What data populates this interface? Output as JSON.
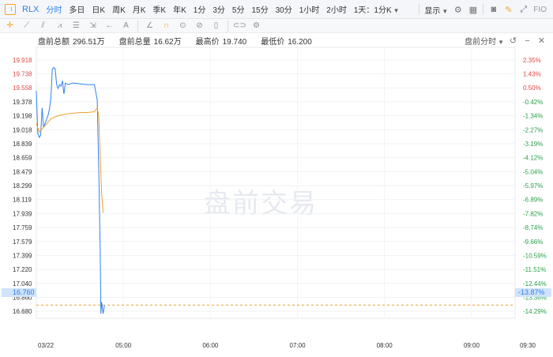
{
  "toolbar": {
    "symbol": "RLX",
    "periods": [
      "分时",
      "多日",
      "日K",
      "周K",
      "月K",
      "季K",
      "年K",
      "1分",
      "3分",
      "5分",
      "15分",
      "30分",
      "1小时",
      "2小时",
      "1天：1分K"
    ],
    "active_period": "分时",
    "display_label": "显示",
    "fio_label": "FIO"
  },
  "info": {
    "total_amount_label": "盘前总额",
    "total_amount": "296.51万",
    "total_volume_label": "盘前总量",
    "total_volume": "16.62万",
    "high_label": "最高价",
    "high": "19.740",
    "low_label": "最低价",
    "low": "16.200",
    "mode_label": "盘前分时"
  },
  "watermark": "盘前交易",
  "current": {
    "price": "16.760",
    "pct": "-13.87%"
  },
  "chart_data": {
    "type": "line",
    "y_left_ticks": [
      "19.918",
      "19.738",
      "19.558",
      "19.378",
      "19.198",
      "19.018",
      "18.839",
      "18.659",
      "18.479",
      "18.299",
      "18.119",
      "17.939",
      "17.759",
      "17.579",
      "17.399",
      "17.220",
      "17.040",
      "16.860",
      "16.680"
    ],
    "y_right_ticks": [
      "2.35%",
      "1.43%",
      "0.50%",
      "-0.42%",
      "-1.34%",
      "-2.27%",
      "-3.19%",
      "-4.12%",
      "-5.04%",
      "-5.97%",
      "-6.89%",
      "-7.82%",
      "-8.74%",
      "-9.66%",
      "-10.59%",
      "-11.51%",
      "-12.44%",
      "-13.36%",
      "-14.29%"
    ],
    "x_ticks": [
      "03/22",
      "05:00",
      "06:00",
      "07:00",
      "08:00",
      "09:00",
      "09:30"
    ],
    "ylim": [
      16.59,
      20.008
    ],
    "x_range_minutes": [
      240,
      570
    ],
    "series": [
      {
        "color": "#2f80ed",
        "x": [
          240,
          241,
          242,
          243,
          244,
          245,
          246,
          247,
          248,
          249,
          250,
          251,
          252,
          253,
          254,
          255,
          256,
          257,
          258,
          259,
          260,
          262,
          265,
          270,
          275,
          280,
          282,
          283,
          284,
          284.5,
          285,
          286,
          287
        ],
        "y": [
          19.52,
          18.97,
          18.92,
          18.95,
          19.3,
          19.05,
          19.1,
          19.15,
          19.2,
          19.28,
          19.42,
          19.8,
          19.82,
          19.8,
          19.6,
          19.55,
          19.6,
          19.58,
          19.65,
          19.48,
          19.62,
          19.6,
          19.62,
          19.61,
          19.6,
          19.6,
          19.4,
          18.5,
          17.5,
          16.65,
          16.8,
          16.65,
          16.76
        ]
      },
      {
        "color": "#f0a030",
        "x": [
          240,
          242,
          245,
          250,
          255,
          260,
          265,
          270,
          275,
          280,
          282,
          283,
          284,
          285,
          286
        ],
        "y": [
          19.1,
          18.99,
          19.05,
          19.16,
          19.2,
          19.22,
          19.23,
          19.24,
          19.24,
          19.25,
          19.3,
          19.2,
          18.7,
          18.2,
          17.95
        ]
      }
    ],
    "reference_price": 19.46
  }
}
